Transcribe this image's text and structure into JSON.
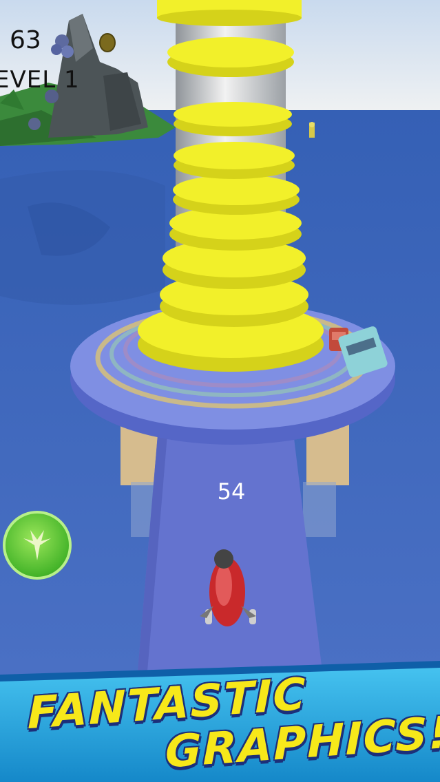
{
  "hud": {
    "score": "63",
    "level": "EVEL 1"
  },
  "road": {
    "count": "54"
  },
  "banner": {
    "line1": "FANTASTIC",
    "line2": "GRAPHICS!"
  },
  "colors": {
    "sea": "#3d63b8",
    "sky": "#dfe9f3",
    "tower_ring": "#f2f02a",
    "platform": "#7d8fe0",
    "banner_bg": "#1fa3dd"
  },
  "icons": {
    "boost": "boost-icon",
    "coin": "coin-icon"
  }
}
